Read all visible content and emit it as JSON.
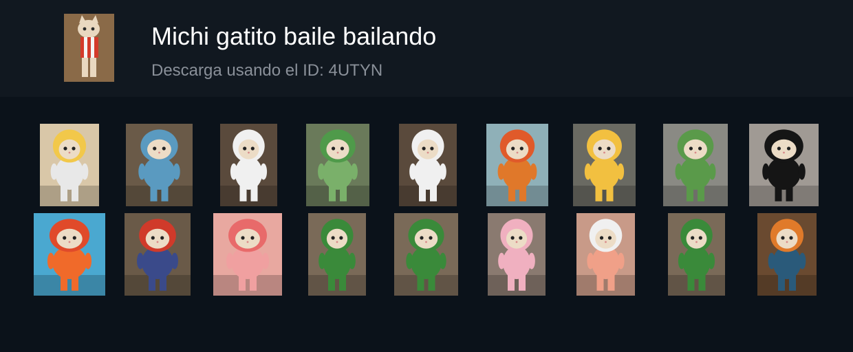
{
  "header": {
    "title": "Michi gatito baile bailando",
    "subtitle": "Descarga usando el ID: 4UTYN"
  },
  "tiles": [
    {
      "name": "baby-chick",
      "bg": "#d9c7a8",
      "hood": "#f2c84a",
      "body": "#e8e8e8"
    },
    {
      "name": "blue-dino",
      "bg": "#6a5a48",
      "hood": "#5a9ac0",
      "body": "#5a9ac0"
    },
    {
      "name": "rooster",
      "bg": "#5a4a3c",
      "hood": "#f0f0f0",
      "body": "#f0f0f0"
    },
    {
      "name": "watermelon-frog",
      "bg": "#6a7a5a",
      "hood": "#4f9a4a",
      "body": "#7ab06a"
    },
    {
      "name": "rooster-2",
      "bg": "#5a4a3c",
      "hood": "#f0f0f0",
      "body": "#f0f0f0"
    },
    {
      "name": "burger",
      "bg": "#8fb0b8",
      "hood": "#e05a2a",
      "body": "#e0782a"
    },
    {
      "name": "pikachu",
      "bg": "#6a6a62",
      "hood": "#f2c040",
      "body": "#f2c040"
    },
    {
      "name": "watermelon",
      "bg": "#8a8a84",
      "hood": "#5a9a4a",
      "body": "#5a9a4a"
    },
    {
      "name": "penguin",
      "bg": "#a09a94",
      "hood": "#151515",
      "body": "#151515"
    },
    {
      "name": "watermelon-beach",
      "bg": "#4aa8d0",
      "hood": "#e04a2a",
      "body": "#f06a2a"
    },
    {
      "name": "mario",
      "bg": "#6a5a48",
      "hood": "#d03a2a",
      "body": "#3a4a8a"
    },
    {
      "name": "pink-cap",
      "bg": "#e8a8a0",
      "hood": "#e86a6a",
      "body": "#f0a0a0"
    },
    {
      "name": "green-dino",
      "bg": "#7a6a58",
      "hood": "#3a8a3a",
      "body": "#3a8a3a"
    },
    {
      "name": "green-dino-2",
      "bg": "#7a6a58",
      "hood": "#3a8a3a",
      "body": "#3a8a3a"
    },
    {
      "name": "pink-unicorn",
      "bg": "#8a7a70",
      "hood": "#f0b0c0",
      "body": "#f0b0c0"
    },
    {
      "name": "orange-bunny",
      "bg": "#c89a88",
      "hood": "#f0f0f0",
      "body": "#f0a088"
    },
    {
      "name": "green-dino-3",
      "bg": "#7a6a58",
      "hood": "#3a8a3a",
      "body": "#3a8a3a"
    },
    {
      "name": "peacock",
      "bg": "#6a4a30",
      "hood": "#e07a2a",
      "body": "#2a5a7a"
    }
  ]
}
